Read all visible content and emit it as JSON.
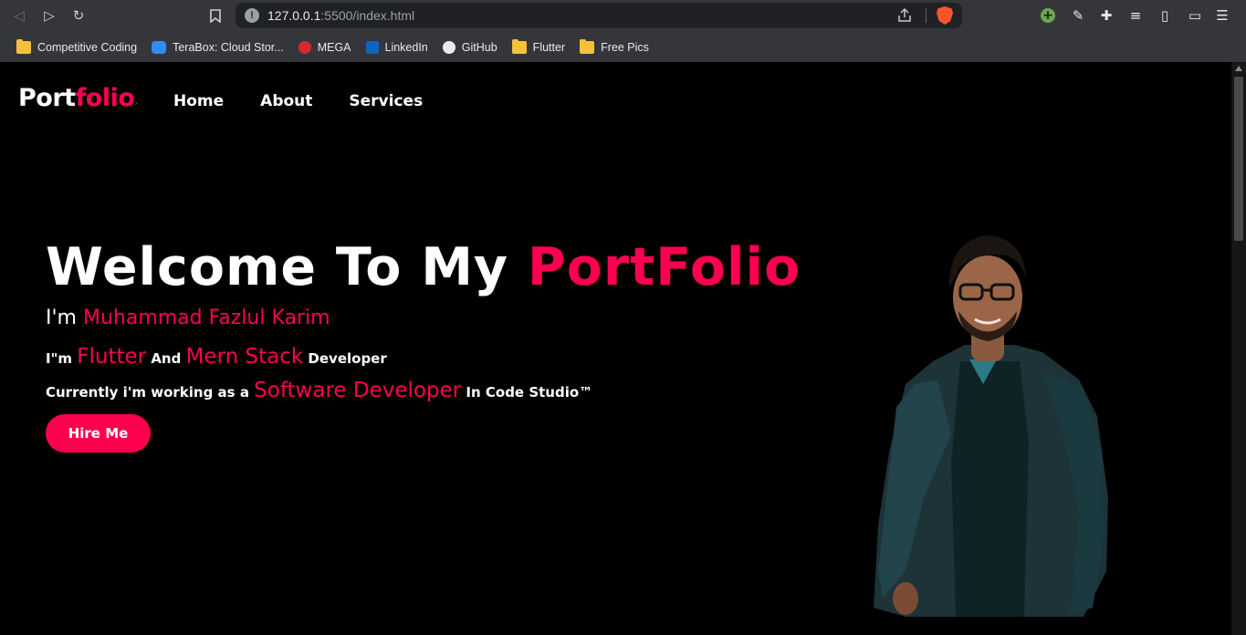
{
  "browser": {
    "url_host": "127.0.0.1",
    "url_rest": ":5500/index.html",
    "bookmarks": [
      {
        "label": "Competitive Coding",
        "icon": "folder-icon"
      },
      {
        "label": "TeraBox: Cloud Stor...",
        "icon": "terabox-icon"
      },
      {
        "label": "MEGA",
        "icon": "mega-icon"
      },
      {
        "label": "LinkedIn",
        "icon": "linkedin-icon"
      },
      {
        "label": "GitHub",
        "icon": "github-icon"
      },
      {
        "label": "Flutter",
        "icon": "folder-icon"
      },
      {
        "label": "Free Pics",
        "icon": "folder-icon"
      }
    ]
  },
  "site": {
    "logo_main": "Port",
    "logo_accent": "folio",
    "nav": [
      "Home",
      "About",
      "Services"
    ]
  },
  "hero": {
    "title_main": "Welcome To My ",
    "title_accent": "PortFolio",
    "intro_prefix": "I'm ",
    "intro_name": "Muhammad Fazlul Karim",
    "role_prefix": "I\"m ",
    "role_1": "Flutter",
    "role_join": " And ",
    "role_2": "Mern Stack",
    "role_suffix": " Developer",
    "work_prefix": "Currently i'm working as a ",
    "work_role": "Software Developer",
    "work_suffix": " In Code Studio™",
    "cta_label": "Hire Me"
  },
  "colors": {
    "accent": "#ff004f",
    "background": "#000000",
    "browser_chrome": "#35363a"
  }
}
